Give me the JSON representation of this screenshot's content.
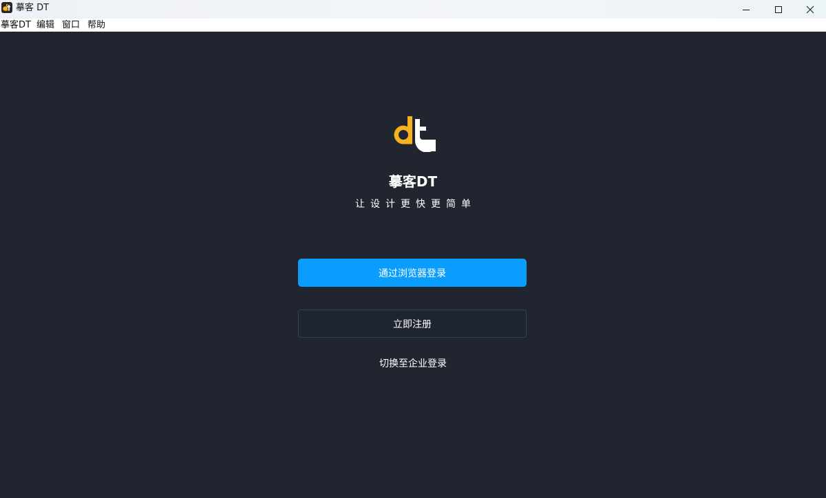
{
  "window": {
    "title": "摹客 DT",
    "controls": {
      "minimize": "minimize-icon",
      "maximize": "maximize-icon",
      "close": "close-icon"
    }
  },
  "menubar": {
    "items": [
      "摹客DT",
      "编辑",
      "窗口",
      "帮助"
    ]
  },
  "main": {
    "brand_name": "摹客DT",
    "slogan": "让设计更快更简单",
    "primary_button": "通过浏览器登录",
    "secondary_button": "立即注册",
    "switch_link": "切换至企业登录"
  },
  "colors": {
    "background": "#20252f",
    "accent": "#0a9dfd",
    "logo_yellow": "#f5b21e",
    "text": "#ffffff"
  }
}
